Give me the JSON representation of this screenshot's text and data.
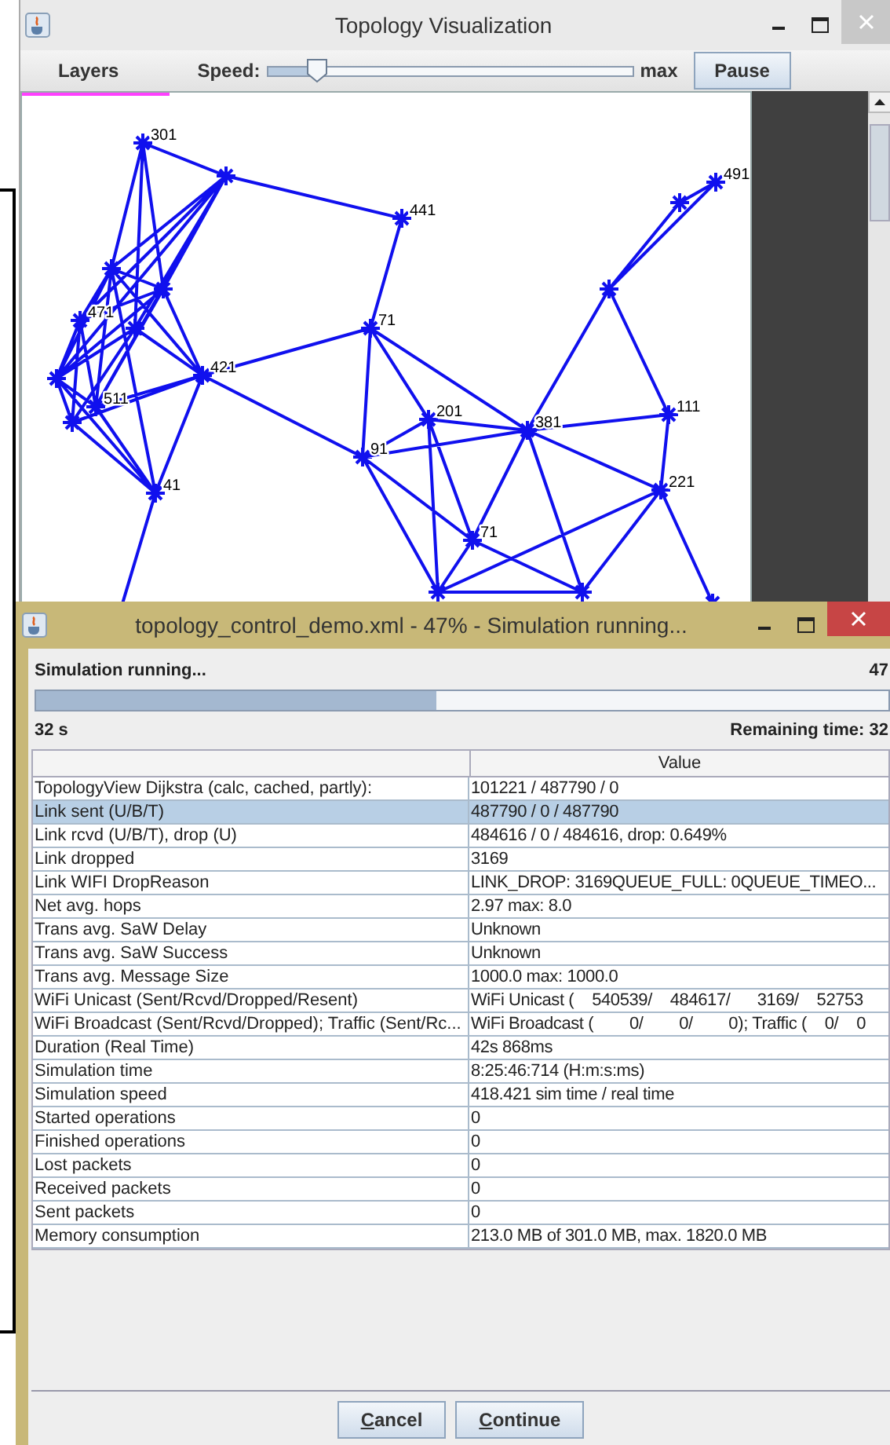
{
  "topology_window": {
    "title": "Topology Visualization",
    "toolbar": {
      "layers": "Layers",
      "speed_label": "Speed:",
      "speed": {
        "level": 0.14
      },
      "max_label": "max",
      "pause": "Pause"
    },
    "graph": {
      "node_labels": [
        {
          "label": "301"
        },
        {
          "label": "441"
        },
        {
          "label": "471"
        },
        {
          "label": "421"
        },
        {
          "label": "511"
        },
        {
          "label": "41"
        },
        {
          "label": "71"
        },
        {
          "label": "201"
        },
        {
          "label": "381"
        },
        {
          "label": "111"
        },
        {
          "label": "221"
        },
        {
          "label": "91"
        },
        {
          "label": "71"
        },
        {
          "label": "491"
        }
      ]
    }
  },
  "dialog": {
    "title": "topology_control_demo.xml - 47% - Simulation running...",
    "status": "Simulation running...",
    "percent": "47",
    "progress": {
      "level": 0.47
    },
    "elapsed": "32 s",
    "remaining": "Remaining time: 32",
    "table": {
      "columns": [
        "Value"
      ],
      "rows": [
        {
          "name": "TopologyView Dijkstra (calc, cached, partly):",
          "value": "101221 / 487790 / 0",
          "selected": false
        },
        {
          "name": "Link sent (U/B/T)",
          "value": "487790 / 0 / 487790",
          "selected": true
        },
        {
          "name": "Link rcvd (U/B/T), drop (U)",
          "value": "484616 / 0 / 484616, drop: 0.649%",
          "selected": false
        },
        {
          "name": "Link dropped",
          "value": "3169",
          "selected": false
        },
        {
          "name": "Link WIFI DropReason",
          "value": "LINK_DROP: 3169QUEUE_FULL: 0QUEUE_TIMEO...",
          "selected": false
        },
        {
          "name": "Net avg. hops",
          "value": "2.97 max: 8.0",
          "selected": false
        },
        {
          "name": "Trans avg. SaW Delay",
          "value": "Unknown",
          "selected": false
        },
        {
          "name": "Trans avg. SaW Success",
          "value": "Unknown",
          "selected": false
        },
        {
          "name": "Trans avg. Message Size",
          "value": "1000.0 max: 1000.0",
          "selected": false
        },
        {
          "name": "WiFi Unicast (Sent/Rcvd/Dropped/Resent)",
          "value": "WiFi Unicast (    540539/    484617/      3169/    52753",
          "selected": false
        },
        {
          "name": "WiFi Broadcast (Sent/Rcvd/Dropped); Traffic (Sent/Rc...",
          "value": "WiFi Broadcast (        0/        0/        0); Traffic (    0/    0",
          "selected": false
        },
        {
          "name": "Duration (Real Time)",
          "value": "42s 868ms",
          "selected": false
        },
        {
          "name": "Simulation time",
          "value": "8:25:46:714 (H:m:s:ms)",
          "selected": false
        },
        {
          "name": "Simulation speed",
          "value": "418.421 sim time / real time",
          "selected": false
        },
        {
          "name": "Started operations",
          "value": "0",
          "selected": false
        },
        {
          "name": "Finished operations",
          "value": "0",
          "selected": false
        },
        {
          "name": "Lost packets",
          "value": "0",
          "selected": false
        },
        {
          "name": "Received packets",
          "value": "0",
          "selected": false
        },
        {
          "name": "Sent packets",
          "value": "0",
          "selected": false
        },
        {
          "name": "Memory consumption",
          "value": "213.0 MB of 301.0 MB, max. 1820.0 MB",
          "selected": false
        }
      ]
    },
    "buttons": [
      "Cancel",
      "Continue"
    ]
  }
}
